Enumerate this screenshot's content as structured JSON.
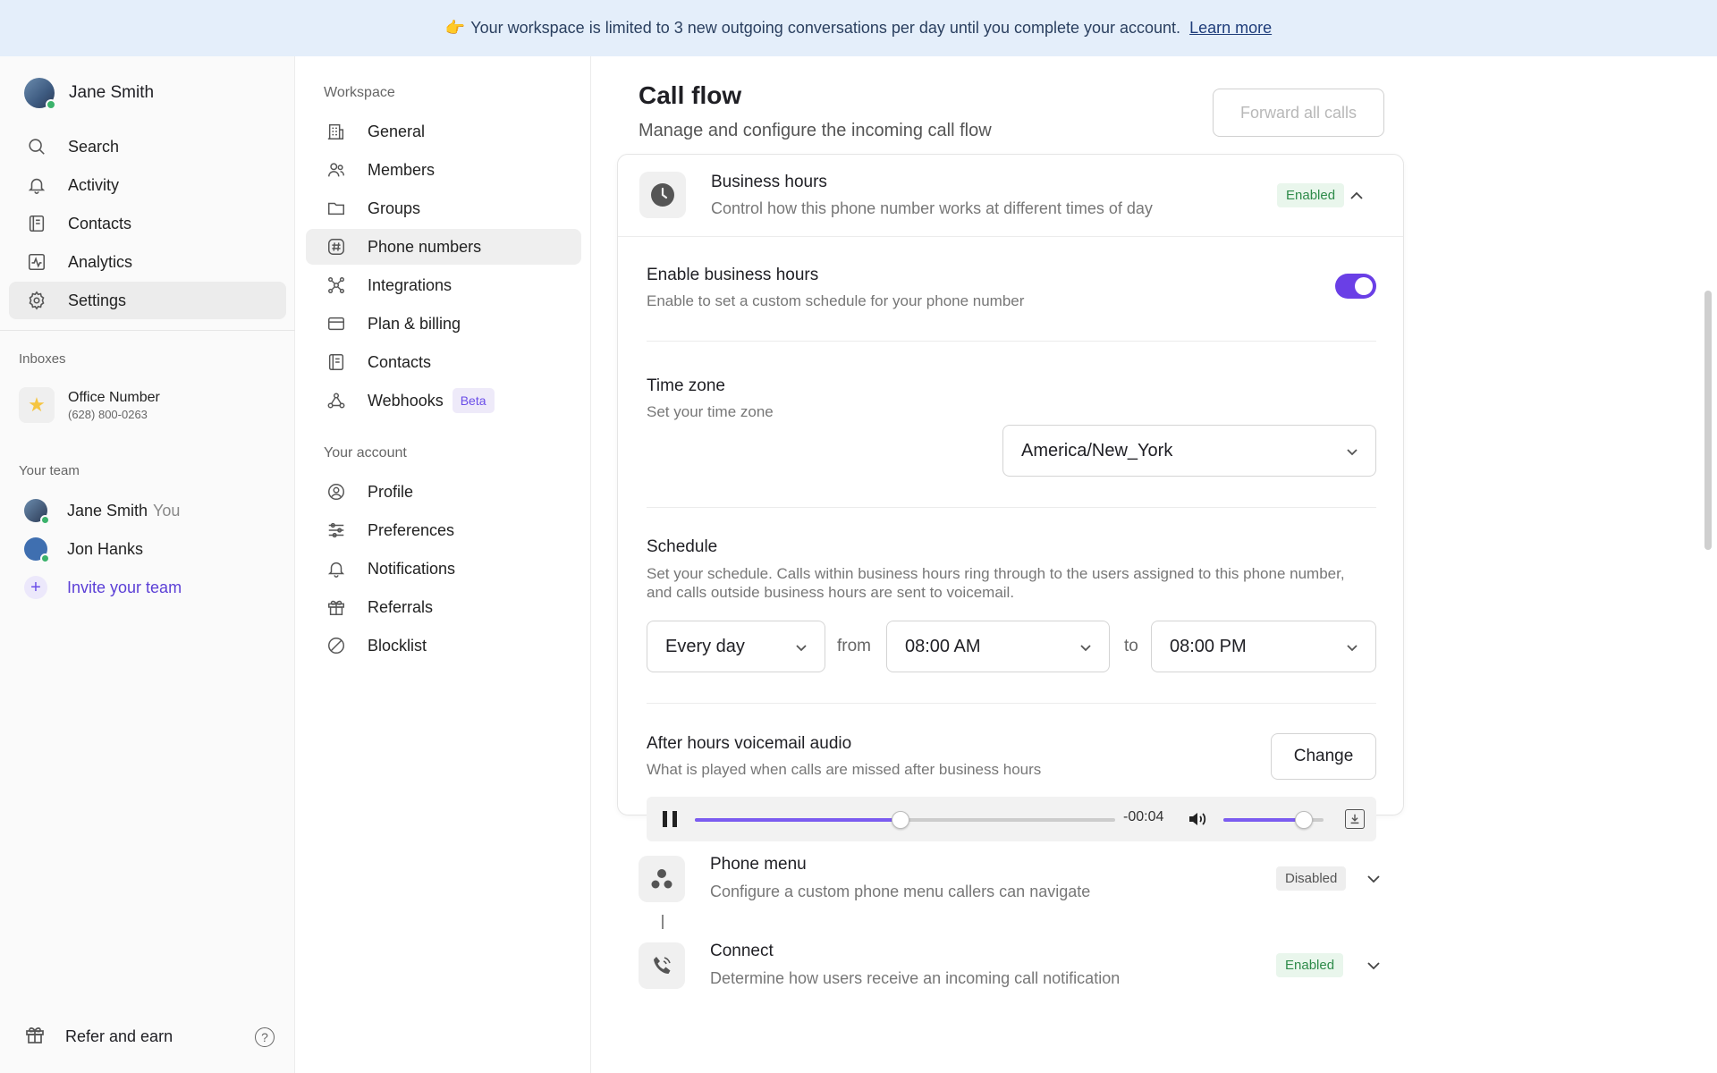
{
  "banner": {
    "emoji": "👉",
    "text": "Your workspace is limited to 3 new outgoing conversations per day until you complete your account.",
    "link": "Learn more"
  },
  "sidebar": {
    "user_name": "Jane Smith",
    "nav": [
      {
        "label": "Search",
        "icon": "search-icon"
      },
      {
        "label": "Activity",
        "icon": "bell-icon"
      },
      {
        "label": "Contacts",
        "icon": "contacts-icon"
      },
      {
        "label": "Analytics",
        "icon": "analytics-icon"
      },
      {
        "label": "Settings",
        "icon": "gear-icon",
        "active": true
      }
    ],
    "inboxes_label": "Inboxes",
    "inbox": {
      "name": "Office Number",
      "number": "(628) 800-0263"
    },
    "team_label": "Your team",
    "team": [
      {
        "name": "Jane Smith",
        "suffix": "You"
      },
      {
        "name": "Jon Hanks"
      }
    ],
    "invite_label": "Invite your team",
    "refer_label": "Refer and earn",
    "help_symbol": "?"
  },
  "settings_nav": {
    "workspace_label": "Workspace",
    "workspace_items": [
      {
        "label": "General",
        "icon": "building-icon"
      },
      {
        "label": "Members",
        "icon": "members-icon"
      },
      {
        "label": "Groups",
        "icon": "folder-icon"
      },
      {
        "label": "Phone numbers",
        "icon": "hash-icon",
        "active": true
      },
      {
        "label": "Integrations",
        "icon": "integrations-icon"
      },
      {
        "label": "Plan & billing",
        "icon": "card-icon"
      },
      {
        "label": "Contacts",
        "icon": "contacts-icon"
      },
      {
        "label": "Webhooks",
        "icon": "webhooks-icon",
        "badge": "Beta"
      }
    ],
    "account_label": "Your account",
    "account_items": [
      {
        "label": "Profile",
        "icon": "profile-icon"
      },
      {
        "label": "Preferences",
        "icon": "sliders-icon"
      },
      {
        "label": "Notifications",
        "icon": "bell-icon"
      },
      {
        "label": "Referrals",
        "icon": "gift-icon"
      },
      {
        "label": "Blocklist",
        "icon": "block-icon"
      }
    ]
  },
  "main": {
    "title": "Call flow",
    "subtitle": "Manage and configure the incoming call flow",
    "forward_button": "Forward all calls",
    "business_hours": {
      "title": "Business hours",
      "desc": "Control how this phone number works at different times of day",
      "status": "Enabled",
      "enable_title": "Enable business hours",
      "enable_desc": "Enable to set a custom schedule for your phone number",
      "enabled": true,
      "timezone_title": "Time zone",
      "timezone_desc": "Set your time zone",
      "timezone_value": "America/New_York",
      "schedule_title": "Schedule",
      "schedule_desc": "Set your schedule. Calls within business hours ring through to the users assigned to this phone number, and calls outside business hours are sent to voicemail.",
      "days_value": "Every day",
      "from_word": "from",
      "from_value": "08:00 AM",
      "to_word": "to",
      "to_value": "08:00 PM",
      "voicemail_title": "After hours voicemail audio",
      "voicemail_desc": "What is played when calls are missed after business hours",
      "change_button": "Change",
      "player": {
        "time": "-00:04",
        "progress": 0.49,
        "volume": 0.8
      }
    },
    "phone_menu": {
      "title": "Phone menu",
      "desc": "Configure a custom phone menu callers can navigate",
      "status": "Disabled"
    },
    "connect": {
      "title": "Connect",
      "desc": "Determine how users receive an incoming call notification",
      "status": "Enabled"
    }
  },
  "colors": {
    "accent": "#6a3fe6",
    "enabled_bg": "#e9f6ec",
    "enabled_text": "#2e8b4a",
    "banner_bg": "#e4eefa"
  }
}
